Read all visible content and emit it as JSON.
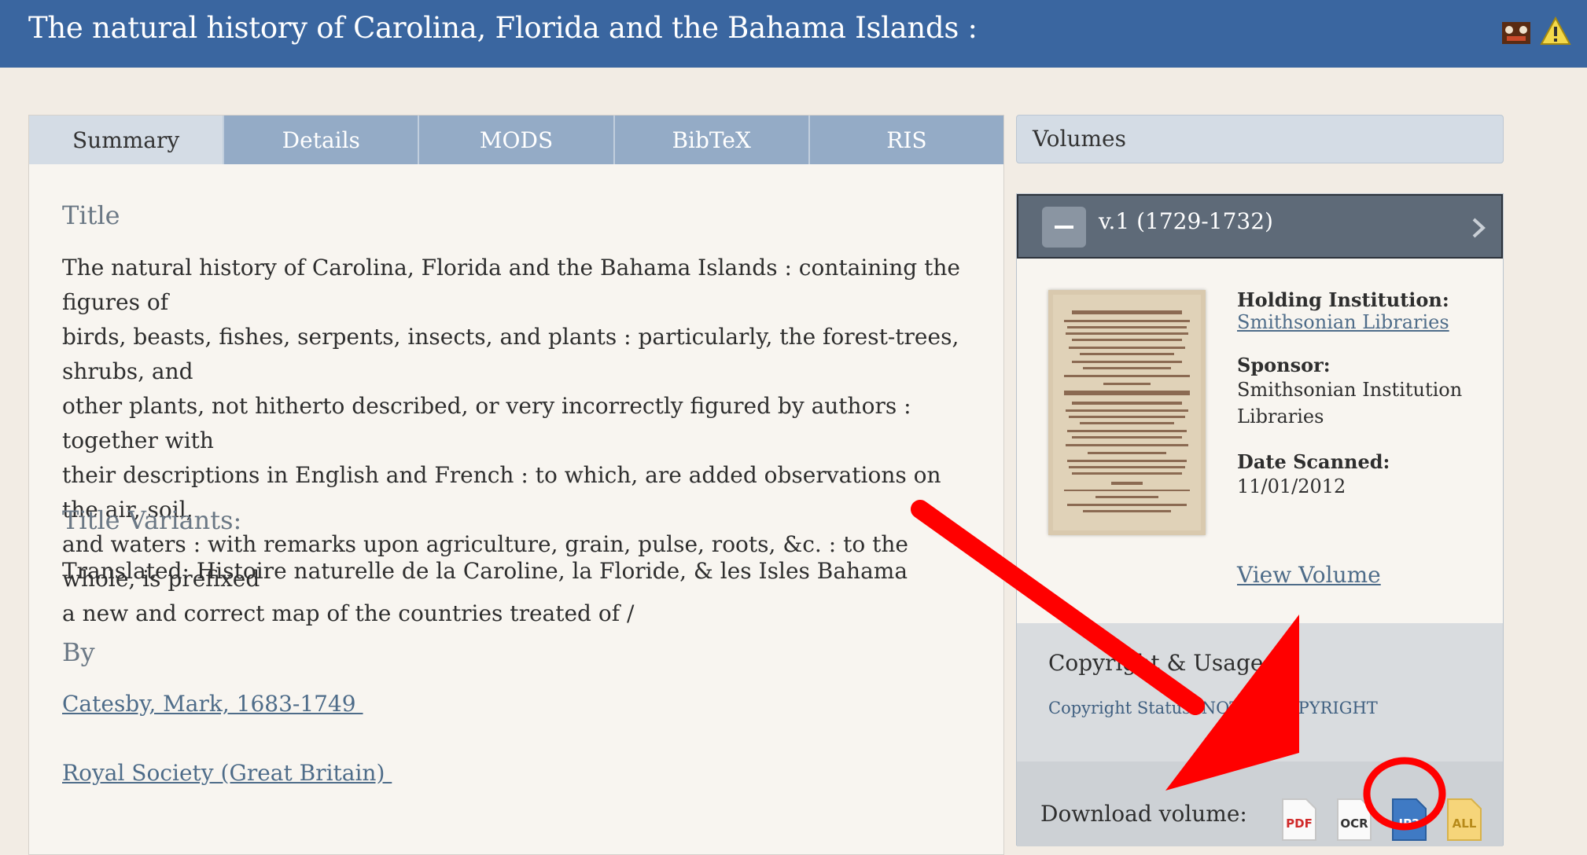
{
  "header": {
    "title": "The natural history of Carolina, Florida and the Bahama Islands :"
  },
  "tabs": [
    {
      "label": "Summary",
      "active": true
    },
    {
      "label": "Details"
    },
    {
      "label": "MODS"
    },
    {
      "label": "BibTeX"
    },
    {
      "label": "RIS"
    }
  ],
  "summary": {
    "title_label": "Title",
    "title_lines": [
      "The natural history of Carolina, Florida and the Bahama Islands : containing the figures of",
      "birds, beasts, fishes, serpents, insects, and plants : particularly, the forest-trees, shrubs, and",
      "other plants, not hitherto described, or very incorrectly figured by authors : together with",
      "their descriptions in English and French : to which, are added observations on the air, soil,",
      "and waters : with remarks upon agriculture, grain, pulse, roots, &c. : to the whole, is prefixed",
      "a new and correct map of the countries treated of /"
    ],
    "variants_label": "Title Variants:",
    "variant": "Translated: Histoire naturelle de la Caroline, la Floride, & les Isles Bahama",
    "by_label": "By",
    "authors": [
      "Catesby, Mark, 1683-1749 ",
      "Royal Society (Great Britain) "
    ]
  },
  "volumes": {
    "header": "Volumes",
    "volume_title": "v.1 (1729-1732)",
    "holding_label": "Holding Institution:",
    "holding_value": "Smithsonian Libraries",
    "sponsor_label": "Sponsor:",
    "sponsor_value_1": "Smithsonian Institution",
    "sponsor_value_2": "Libraries",
    "date_label": "Date Scanned:",
    "date_value": "11/01/2012",
    "view_volume": "View Volume",
    "copyright_label": "Copyright & Usage:",
    "copyright_status": "Copyright Status: NOT IN COPYRIGHT",
    "download_label": "Download volume:",
    "downloads": [
      "PDF",
      "OCR",
      "JP2",
      "ALL"
    ]
  },
  "colors": {
    "header_bg": "#3a66a0",
    "tab_bg": "#94abc6",
    "link": "#4e6c89",
    "annotation": "#ff0000"
  }
}
